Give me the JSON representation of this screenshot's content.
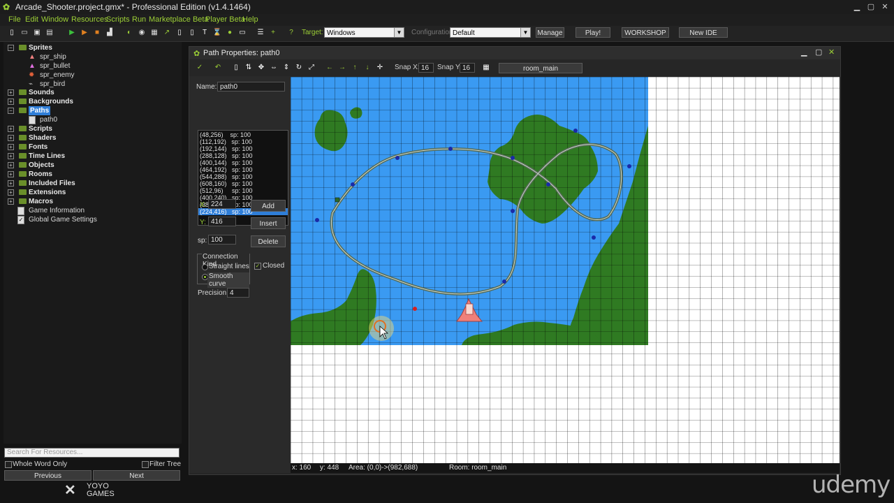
{
  "window": {
    "title": "Arcade_Shooter.project.gmx* - Professional Edition (v1.4.1464)"
  },
  "menu": [
    "File",
    "Edit",
    "Window",
    "Resources",
    "Scripts",
    "Run",
    "Marketplace Beta",
    "Player Beta",
    "Help"
  ],
  "toolbar": {
    "target_label": "Target:",
    "target_value": "Windows",
    "config_label": "Configuration:",
    "config_value": "Default",
    "manage": "Manage",
    "play": "Play!",
    "workshop": "WORKSHOP",
    "new_ide": "New IDE"
  },
  "tree": {
    "sprites": "Sprites",
    "spr_ship": "spr_ship",
    "spr_bullet": "spr_bullet",
    "spr_enemy": "spr_enemy",
    "spr_bird": "spr_bird",
    "sounds": "Sounds",
    "backgrounds": "Backgrounds",
    "paths": "Paths",
    "path0": "path0",
    "scripts": "Scripts",
    "shaders": "Shaders",
    "fonts": "Fonts",
    "timelines": "Time Lines",
    "objects": "Objects",
    "rooms": "Rooms",
    "included": "Included Files",
    "extensions": "Extensions",
    "macros": "Macros",
    "gameinfo": "Game Information",
    "gamesettings": "Global Game Settings"
  },
  "bottom": {
    "search_placeholder": "Search For Resources...",
    "whole_word": "Whole Word Only",
    "filter_tree": "Filter Tree",
    "previous": "Previous",
    "next": "Next",
    "logo_top": "YOYO",
    "logo_bottom": "GAMES"
  },
  "path_window": {
    "title": "Path Properties: path0",
    "snap_x_label": "Snap X:",
    "snap_x": "16",
    "snap_y_label": "Snap Y:",
    "snap_y": "16",
    "room": "room_main",
    "name_label": "Name:",
    "name": "path0",
    "points": [
      "(48,256)    sp: 100",
      "(112,192)   sp: 100",
      "(192,144)   sp: 100",
      "(288,128)   sp: 100",
      "(400,144)   sp: 100",
      "(464,192)   sp: 100",
      "(544,288)   sp: 100",
      "(608,160)   sp: 100",
      "(512,96)     sp: 100",
      "(400,240)   sp: 100",
      "(384,368)   sp: 100",
      "(224,416)   sp: 100"
    ],
    "x_label": "X:",
    "x": "224",
    "y_label": "Y:",
    "y": "416",
    "sp_label": "sp:",
    "sp": "100",
    "add": "Add",
    "insert": "Insert",
    "delete": "Delete",
    "connection_kind": "Connection Kind",
    "straight": "Straight lines",
    "smooth": "Smooth curve",
    "closed": "Closed",
    "precision_label": "Precision:",
    "precision": "4",
    "status_x": "x: 160",
    "status_y": "y: 448",
    "status_area": "Area: (0,0)->(982,688)",
    "status_room": "Room: room_main"
  },
  "watermark": "udemy",
  "colors": {
    "accent": "#9ccf36",
    "water": "#3a9af2",
    "land": "#2f7a22",
    "selection": "#2f7ed8"
  }
}
